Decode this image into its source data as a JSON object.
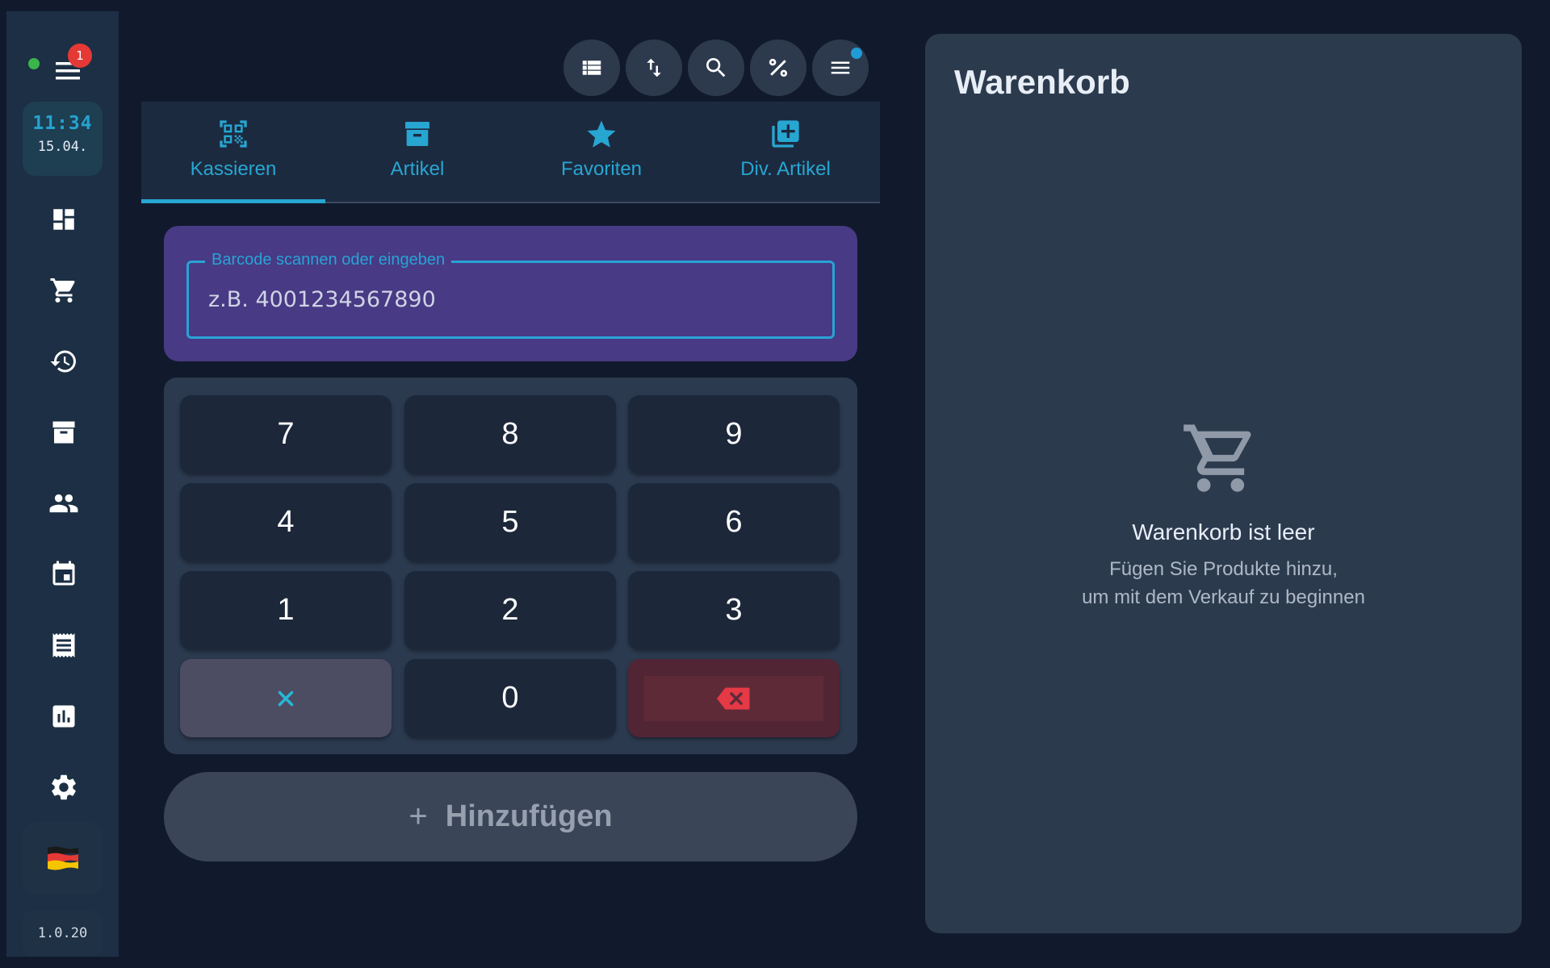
{
  "sidebar": {
    "notification_count": "1",
    "clock": {
      "time": "11:34",
      "date": "15.04."
    },
    "nav_items": [
      "dashboard-icon",
      "cart-icon",
      "history-icon",
      "archive-icon",
      "customers-icon",
      "calendar-icon",
      "receipt-icon",
      "reports-icon",
      "settings-icon"
    ],
    "language_flag": "🇩🇪",
    "version": "1.0.20"
  },
  "toolbar": {
    "buttons": [
      "list-icon",
      "sort-icon",
      "search-icon",
      "percent-icon",
      "menu-icon"
    ]
  },
  "tabs": [
    {
      "label": "Kassieren",
      "icon": "qr-scan-icon",
      "active": true
    },
    {
      "label": "Artikel",
      "icon": "archive-box-icon",
      "active": false
    },
    {
      "label": "Favoriten",
      "icon": "star-icon",
      "active": false
    },
    {
      "label": "Div. Artikel",
      "icon": "add-to-library-icon",
      "active": false
    }
  ],
  "barcode": {
    "label": "Barcode scannen oder eingeben",
    "placeholder": "z.B. 4001234567890",
    "value": ""
  },
  "keypad": {
    "keys": [
      "7",
      "8",
      "9",
      "4",
      "5",
      "6",
      "1",
      "2",
      "3",
      "0"
    ]
  },
  "add_button": {
    "label": "Hinzufügen"
  },
  "cart": {
    "title": "Warenkorb",
    "empty_title": "Warenkorb ist leer",
    "empty_line1": "Fügen Sie Produkte hinzu,",
    "empty_line2": "um mit dem Verkauf zu beginnen"
  },
  "colors": {
    "accent": "#27a6d2",
    "background": "#111a2d",
    "sidebar": "#1c2f44",
    "barcode_panel": "#483a84",
    "status_online": "#3bb54a",
    "notification": "#e53935",
    "backspace": "#e53935"
  }
}
